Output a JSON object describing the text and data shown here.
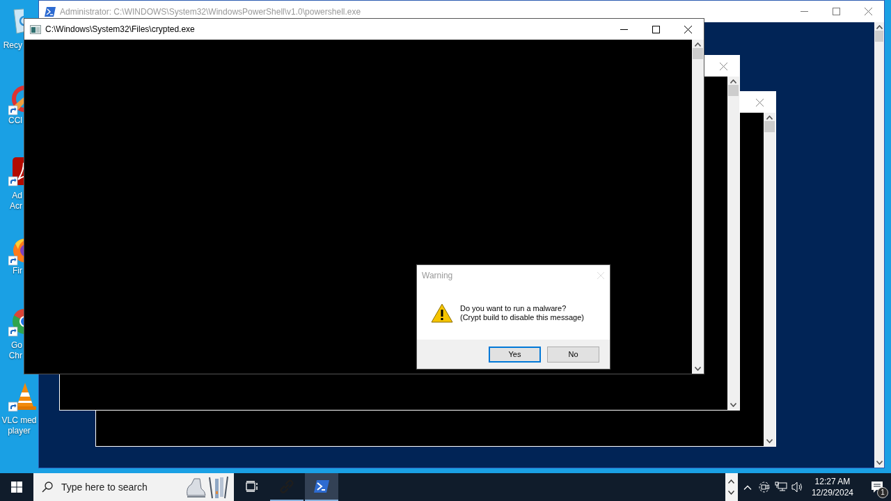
{
  "desktop_icons": [
    {
      "kind": "recycle-bin",
      "lines": [
        "Recy"
      ],
      "shortcut": false
    },
    {
      "kind": "cleaner",
      "lines": [
        "CCl"
      ],
      "shortcut": true
    },
    {
      "kind": "acrobat",
      "lines": [
        "Ad",
        "Acr"
      ],
      "shortcut": true
    },
    {
      "kind": "firefox",
      "lines": [
        "Fir"
      ],
      "shortcut": true
    },
    {
      "kind": "chrome",
      "lines": [
        "Go",
        "Chr"
      ],
      "shortcut": true
    },
    {
      "kind": "vlc",
      "lines": [
        "VLC med",
        "player"
      ],
      "shortcut": true
    }
  ],
  "powershell_window": {
    "title": "Administrator: C:\\WINDOWS\\System32\\WindowsPowerShell\\v1.0\\powershell.exe",
    "active": false
  },
  "console_windows": [
    {
      "kind": "untitled"
    },
    {
      "kind": "untitled"
    },
    {
      "kind": "titled",
      "title": "C:\\Windows\\System32\\Files\\crypted.exe",
      "active": true
    }
  ],
  "dialog": {
    "title": "Warning",
    "message_lines": [
      "Do you want to run a malware?",
      "(Crypt build to disable this message)"
    ],
    "buttons": [
      {
        "label": "Yes",
        "default": true
      },
      {
        "label": "No",
        "default": false
      }
    ]
  },
  "taskbar": {
    "search": {
      "placeholder": "Type here to search"
    },
    "apps": [
      {
        "kind": "task-view",
        "running": false,
        "active": false
      },
      {
        "kind": "link",
        "running": true,
        "active": false
      },
      {
        "kind": "powershell",
        "running": true,
        "active": true
      }
    ],
    "tray_icons": [
      {
        "kind": "chevron"
      },
      {
        "kind": "meet"
      },
      {
        "kind": "network"
      },
      {
        "kind": "volume"
      }
    ],
    "clock": {
      "time": "12:27 AM",
      "date": "12/29/2024"
    },
    "notifications": {
      "badge": "1"
    }
  }
}
